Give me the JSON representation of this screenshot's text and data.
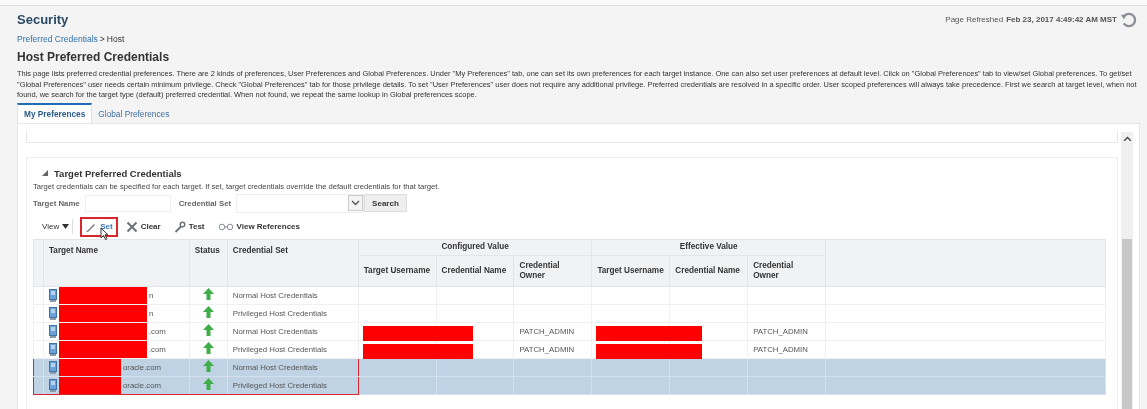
{
  "header": {
    "title": "Security",
    "refreshed_label": "Page Refreshed",
    "refreshed_time": "Feb 23, 2017 4:49:42 AM MST"
  },
  "breadcrumb": {
    "link": "Preferred Credentials",
    "separator": ">",
    "current": "Host"
  },
  "page_title": "Host Preferred Credentials",
  "description": "This page lists preferred credential preferences. There are 2 kinds of preferences, User Preferences and Global Preferences. Under \"My Preferences\" tab, one can set its own preferences for each target instance. One can also set user preferences at default level. Click on \"Global Preferences\" tab to view/set Global preferences. To get/set \"Global Preferences\" user needs certain minimum privilege. Check \"Global Preferences\" tab for those privilege details. To set \"User Preferences\" user does not require any additional privilege. Preferred credentials are resolved in a specific order. User scoped preferences will always take precedence. First we search at target level, when not found, we search for the target type (default) preferred credential. When not found, we repeat the same lookup in Global preferences scope.",
  "tabs": [
    {
      "label": "My Preferences",
      "selected": true
    },
    {
      "label": "Global Preferences",
      "selected": false
    }
  ],
  "section": {
    "title": "Target Preferred Credentials",
    "expanded": true,
    "description": "Target credentials can be specified for each target. If set, target credentials override the default credentials for that target.",
    "filters": [
      {
        "label": "Target Name",
        "kind": "text"
      },
      {
        "label": "Credential Set",
        "kind": "select"
      }
    ],
    "search_button": "Search",
    "toolbar": [
      {
        "label": "View",
        "kind": "menu",
        "highlighted": false
      },
      {
        "label": "Set",
        "kind": "pencil",
        "highlighted": true
      },
      {
        "label": "Clear",
        "kind": "cross",
        "highlighted": false
      },
      {
        "label": "Test",
        "kind": "wrench",
        "highlighted": false
      },
      {
        "label": "View References",
        "kind": "glasses",
        "highlighted": false
      }
    ],
    "table": {
      "columns": {
        "target_name": "Target Name",
        "status": "Status",
        "credential_set": "Credential Set"
      },
      "groups": [
        {
          "title": "Configured Value",
          "columns": [
            "Target Username",
            "Credential Name",
            "Credential Owner"
          ]
        },
        {
          "title": "Effective Value",
          "columns": [
            "Target Username",
            "Credential Name",
            "Credential Owner"
          ]
        }
      ],
      "rows": [
        {
          "target_name": "n",
          "redaction_wide": true,
          "status_up": true,
          "credential_set": "Normal Host Credentials",
          "values_redacted": false,
          "selected": false,
          "outlined": false
        },
        {
          "target_name": "n",
          "redaction_wide": true,
          "status_up": true,
          "credential_set": "Privileged Host Credentials",
          "values_redacted": false,
          "selected": false,
          "outlined": false
        },
        {
          "target_name": ".com",
          "redaction_wide": true,
          "status_up": true,
          "credential_set": "Normal Host Credentials",
          "configured_owner": "PATCH_ADMIN",
          "effective_owner": "PATCH_ADMIN",
          "values_redacted": true,
          "selected": false,
          "outlined": false
        },
        {
          "target_name": ".com",
          "redaction_wide": true,
          "status_up": true,
          "credential_set": "Privileged Host Credentials",
          "configured_owner": "PATCH_ADMIN",
          "effective_owner": "PATCH_ADMIN",
          "values_redacted": true,
          "selected": false,
          "outlined": false
        },
        {
          "target_name": "oracle.com",
          "redaction_wide": false,
          "status_up": true,
          "credential_set": "Normal Host Credentials",
          "values_redacted": false,
          "selected": true,
          "outlined": true
        },
        {
          "target_name": "oracle.com",
          "redaction_wide": false,
          "status_up": true,
          "credential_set": "Privileged Host Credentials",
          "values_redacted": false,
          "selected": true,
          "outlined": true
        }
      ]
    }
  }
}
